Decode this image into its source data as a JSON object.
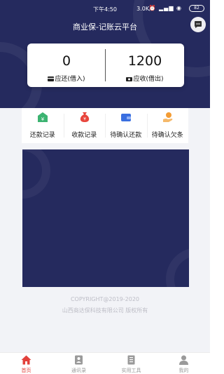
{
  "status_bar": {
    "time": "下午4:50",
    "network_speed": "3.0K/s",
    "battery": "82"
  },
  "app": {
    "title": "商业保-记账云平台"
  },
  "balance": {
    "owed": {
      "value": "0",
      "label": "应还(借入)"
    },
    "receivable": {
      "value": "1200",
      "label": "应收(借出)"
    }
  },
  "quick_actions": [
    {
      "label": "还款记录",
      "icon": "repay-record-icon",
      "color": "#3cb371"
    },
    {
      "label": "收款记录",
      "icon": "money-bag-icon",
      "color": "#e8453c"
    },
    {
      "label": "待确认还款",
      "icon": "wallet-icon",
      "color": "#3a6fe0"
    },
    {
      "label": "待确认欠条",
      "icon": "hand-coin-icon",
      "color": "#f39c34"
    }
  ],
  "footer": {
    "copyright": "COPYRIGHT@2019-2020",
    "company": "山西商达保科技有限公司 版权所有"
  },
  "tab_bar": [
    {
      "label": "首页",
      "icon": "home-icon",
      "active": true
    },
    {
      "label": "通讯录",
      "icon": "contacts-icon",
      "active": false
    },
    {
      "label": "实用工具",
      "icon": "tools-icon",
      "active": false
    },
    {
      "label": "我的",
      "icon": "user-icon",
      "active": false
    }
  ],
  "colors": {
    "primary": "#252a5e",
    "accent": "#e2413b",
    "background": "#f2f3f7"
  }
}
